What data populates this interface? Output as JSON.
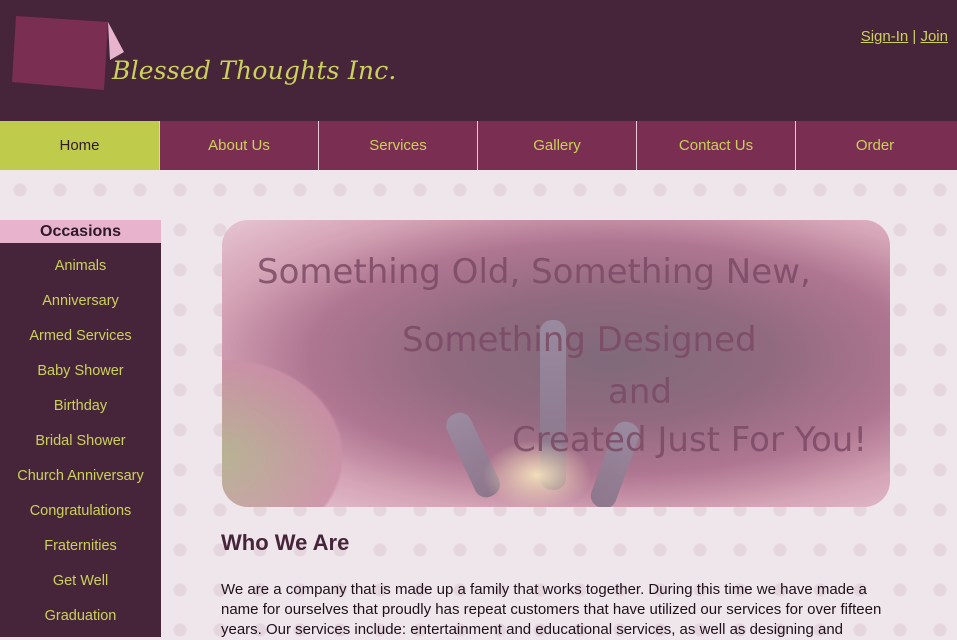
{
  "brand": {
    "name": "Blessed Thoughts Inc.",
    "colors": {
      "header": "#46253a",
      "accent": "#cbd15a",
      "nav": "#7a2f52",
      "active": "#bfcb4a"
    }
  },
  "auth": {
    "sign_in": "Sign-In",
    "separator": " | ",
    "join": "Join"
  },
  "nav": {
    "items": [
      {
        "label": "Home"
      },
      {
        "label": "About Us"
      },
      {
        "label": "Services"
      },
      {
        "label": "Gallery"
      },
      {
        "label": "Contact Us"
      },
      {
        "label": "Order"
      }
    ]
  },
  "sidebar": {
    "heading": "Occasions",
    "items": [
      {
        "label": "Animals"
      },
      {
        "label": "Anniversary"
      },
      {
        "label": "Armed Services"
      },
      {
        "label": "Baby Shower"
      },
      {
        "label": "Birthday"
      },
      {
        "label": "Bridal Shower"
      },
      {
        "label": "Church Anniversary"
      },
      {
        "label": "Congratulations"
      },
      {
        "label": "Fraternities"
      },
      {
        "label": "Get Well"
      },
      {
        "label": "Graduation"
      }
    ]
  },
  "hero": {
    "line1": "Something Old, Something New,",
    "line2": "Something Designed",
    "line3": "and",
    "line4": "Created Just For You!"
  },
  "about": {
    "title": "Who We Are",
    "body": "We are a company that is made up a family that works together. During this time we have made a name for ourselves that proudly has repeat customers that have utilized our services for over fifteen years. Our services include: entertainment and educational services, as well as designing and"
  }
}
